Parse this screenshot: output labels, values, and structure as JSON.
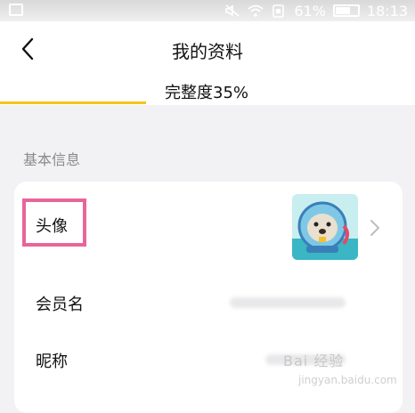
{
  "status_bar": {
    "battery_percent": "61%",
    "time": "18:13"
  },
  "header": {
    "title": "我的资料"
  },
  "tabs": [
    {
      "label": "完整度35%",
      "active": true
    }
  ],
  "section": {
    "title": "基本信息"
  },
  "rows": [
    {
      "label": "头像"
    },
    {
      "label": "会员名"
    },
    {
      "label": "昵称"
    }
  ],
  "colors": {
    "accent": "#f5c518",
    "highlight": "#e8659a"
  },
  "watermark": {
    "text": "Bai 经验",
    "sub": "jingyan.baidu.com"
  }
}
